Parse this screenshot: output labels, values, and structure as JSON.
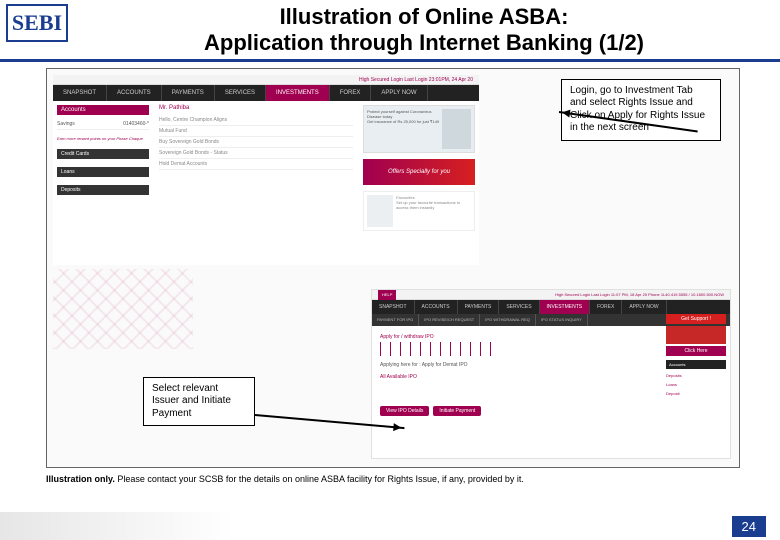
{
  "logo": "SEBI",
  "title_line1": "Illustration of Online ASBA:",
  "title_line2": "Application through Internet Banking (1/2)",
  "calloutA": "Login, go to Investment Tab and select Rights Issue and Click on Apply for Rights Issue in the next screen",
  "calloutB": "Select relevant Issuer and Initiate Payment",
  "footnote_lead": "Illustration only.",
  "footnote_rest": " Please contact your SCSB for the details on online ASBA facility for Rights Issue, if any, provided by it.",
  "page_number": "24",
  "bankA": {
    "top_status": "High Secured Login   Last Login 23:01PM, 24 Apr 20",
    "nav": [
      "SNAPSHOT",
      "ACCOUNTS",
      "PAYMENTS",
      "SERVICES",
      "INVESTMENTS",
      "FOREX",
      "APPLY NOW"
    ],
    "nav_active_index": 4,
    "side_header": "Accounts",
    "side_row_label": "Savings",
    "side_row_value": "01403460-*",
    "side_cta": "Earn more reward points on your Phase Chaque",
    "side_sections": [
      "Credit Cards",
      "Loans",
      "Deposits"
    ],
    "greeting": "Mr. Pathiba",
    "greeting_sub": "Hello, Centre Champion Aligns",
    "mid_items": [
      "Mutual Fund",
      "Buy Sovereign Gold Bonds",
      "Sovereign Gold Bonds - Status",
      "Hold Demat Accounts"
    ],
    "promo1_title": "Protect yourself against Coronavirus Disease today",
    "promo1_sub": "Get insurance of Rs 25,000 for just ₹149",
    "offers_banner": "Offers Specially for you",
    "fav_title": "Favourites",
    "fav_sub": "Set up your favourite transactions to access them instantly"
  },
  "bankB": {
    "help": "HELP",
    "top_status": "High Secured Login   Last Login  11:07 PM, 18 Apr 20     Phone 1L40.419.5555 / 10.1800.500.NOW",
    "nav": [
      "SNAPSHOT",
      "ACCOUNTS",
      "PAYMENTS",
      "SERVICES",
      "INVESTMENTS",
      "FOREX",
      "APPLY NOW"
    ],
    "nav_active_index": 4,
    "sub_nav": [
      "PAYMENT FOR IPO",
      "IPO REVISE/CH REQUEST",
      "IPO WITHDRAWAL REQ",
      "IPO STATUS INQUIRY"
    ],
    "getsupport_title": "Get Support !",
    "getsupport_btn": "Click Here",
    "label1": "Apply for / withdraw IPO",
    "label2": "Applying here for :  Apply for Demat IPO",
    "label3": "All Available IPO",
    "btn_view": "View IPO Details",
    "btn_pay": "Initiate Payment",
    "rside_header": "Accounts",
    "rside_items": [
      "Deposits",
      "Loans",
      "Deposit"
    ]
  }
}
